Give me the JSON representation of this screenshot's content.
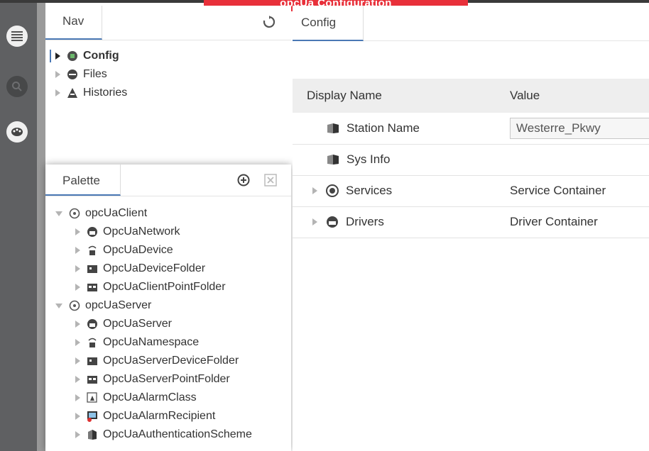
{
  "banner": {
    "text": "opcUa Configuration"
  },
  "rail": {
    "items": [
      "menu-icon",
      "search-icon",
      "palette-icon"
    ]
  },
  "nav": {
    "tab_label": "Nav",
    "items": [
      {
        "label": "Config",
        "icon": "config-icon",
        "expanded": false,
        "bold": true
      },
      {
        "label": "Files",
        "icon": "files-icon",
        "expanded": false
      },
      {
        "label": "Histories",
        "icon": "histories-icon",
        "expanded": false
      }
    ]
  },
  "palette": {
    "tab_label": "Palette",
    "groups": [
      {
        "label": "opcUaClient",
        "items": [
          "OpcUaNetwork",
          "OpcUaDevice",
          "OpcUaDeviceFolder",
          "OpcUaClientPointFolder"
        ]
      },
      {
        "label": "opcUaServer",
        "items": [
          "OpcUaServer",
          "OpcUaNamespace",
          "OpcUaServerDeviceFolder",
          "OpcUaServerPointFolder",
          "OpcUaAlarmClass",
          "OpcUaAlarmRecipient",
          "OpcUaAuthenticationScheme"
        ]
      }
    ]
  },
  "config": {
    "tab_label": "Config",
    "columns": [
      "Display Name",
      "Value"
    ],
    "rows": [
      {
        "name": "Station Name",
        "value": "Westerre_Pkwy",
        "editable": true,
        "expandable": false
      },
      {
        "name": "Sys Info",
        "value": "",
        "editable": false,
        "expandable": false
      },
      {
        "name": "Services",
        "value": "Service Container",
        "editable": false,
        "expandable": true
      },
      {
        "name": "Drivers",
        "value": "Driver Container",
        "editable": false,
        "expandable": true
      }
    ]
  },
  "colors": {
    "accent": "#4a78b5",
    "banner": "#e8303a",
    "rail": "#5f6062"
  }
}
